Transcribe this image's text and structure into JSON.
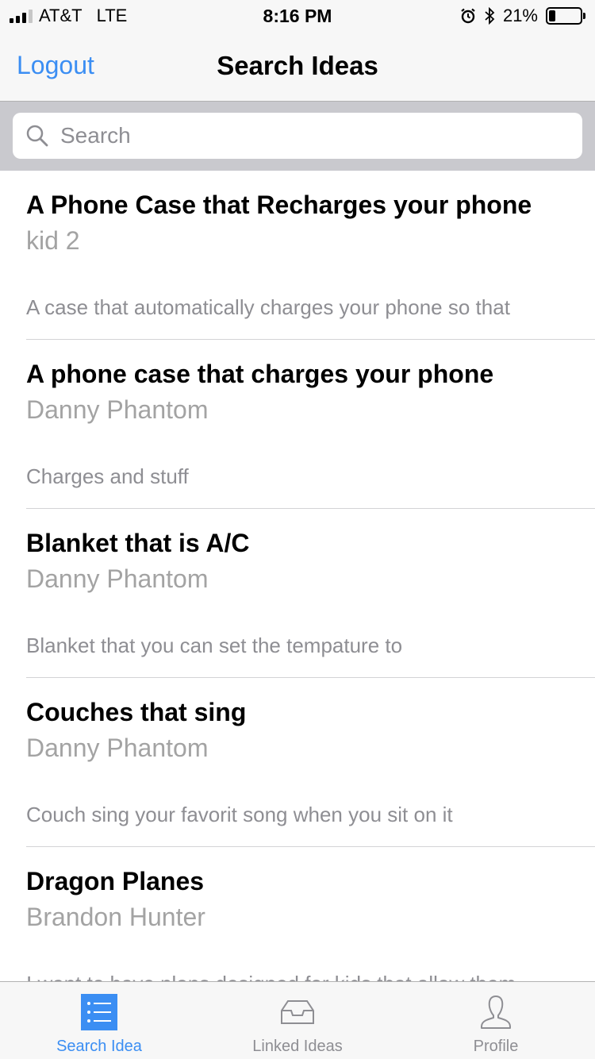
{
  "status_bar": {
    "carrier": "AT&T",
    "network": "LTE",
    "time": "8:16 PM",
    "battery_text": "21%",
    "battery_level": 0.21,
    "icons": [
      "signal-icon",
      "alarm-icon",
      "bluetooth-icon",
      "battery-icon"
    ]
  },
  "nav": {
    "left_button": "Logout",
    "title": "Search Ideas"
  },
  "search": {
    "placeholder": "Search",
    "value": ""
  },
  "ideas": [
    {
      "title": "A Phone Case that Recharges your phone",
      "author": "kid 2",
      "description": "A case that automatically charges your phone so that"
    },
    {
      "title": "A phone case that charges your phone",
      "author": "Danny Phantom",
      "description": "Charges and stuff"
    },
    {
      "title": "Blanket that is A/C",
      "author": "Danny Phantom",
      "description": "Blanket that you can set the tempature to"
    },
    {
      "title": "Couches that sing",
      "author": "Danny Phantom",
      "description": "Couch sing your favorit song when you sit on it"
    },
    {
      "title": "Dragon Planes",
      "author": "Brandon Hunter",
      "description": "I want to have plans designed for kids that allow them"
    }
  ],
  "tabs": [
    {
      "label": "Search Idea",
      "icon": "list-icon",
      "active": true
    },
    {
      "label": "Linked Ideas",
      "icon": "inbox-icon",
      "active": false
    },
    {
      "label": "Profile",
      "icon": "person-icon",
      "active": false
    }
  ],
  "colors": {
    "accent": "#3b8ef3",
    "bar_background": "#f7f7f7",
    "search_background": "#c9c9ce",
    "secondary_text": "#8e8e93"
  }
}
